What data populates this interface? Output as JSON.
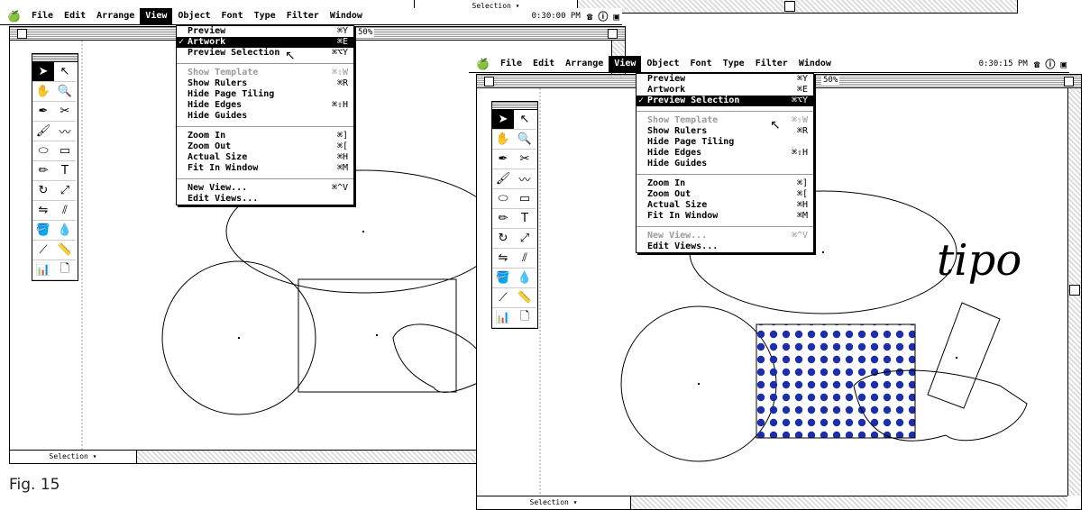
{
  "caption": "Fig. 15",
  "menubar": {
    "apple_icon": "apple-logo",
    "items": [
      "File",
      "Edit",
      "Arrange",
      "View",
      "Object",
      "Font",
      "Type",
      "Filter",
      "Window"
    ],
    "active_item": "View",
    "left_clock": "0:30:00 PM",
    "right_clock": "0:30:15 PM"
  },
  "top_strip": {
    "status_label": "Selection"
  },
  "left_window": {
    "zoom_label": "50%",
    "status_label": "Selection",
    "view_menu": [
      {
        "label": "Preview",
        "shortcut": "⌘Y",
        "disabled": false,
        "checked": false,
        "highlighted": false
      },
      {
        "label": "Artwork",
        "shortcut": "⌘E",
        "disabled": false,
        "checked": true,
        "highlighted": true
      },
      {
        "label": "Preview Selection",
        "shortcut": "⌘⌥Y",
        "disabled": false,
        "checked": false,
        "highlighted": false
      },
      {
        "separator": true
      },
      {
        "label": "Show Template",
        "shortcut": "⌘⇧W",
        "disabled": true,
        "checked": false,
        "highlighted": false
      },
      {
        "label": "Show Rulers",
        "shortcut": "⌘R",
        "disabled": false,
        "checked": false,
        "highlighted": false
      },
      {
        "label": "Hide Page Tiling",
        "shortcut": "",
        "disabled": false,
        "checked": false,
        "highlighted": false
      },
      {
        "label": "Hide Edges",
        "shortcut": "⌘⇧H",
        "disabled": false,
        "checked": false,
        "highlighted": false
      },
      {
        "label": "Hide Guides",
        "shortcut": "",
        "disabled": false,
        "checked": false,
        "highlighted": false
      },
      {
        "separator": true
      },
      {
        "label": "Zoom In",
        "shortcut": "⌘]",
        "disabled": false,
        "checked": false,
        "highlighted": false
      },
      {
        "label": "Zoom Out",
        "shortcut": "⌘[",
        "disabled": false,
        "checked": false,
        "highlighted": false
      },
      {
        "label": "Actual Size",
        "shortcut": "⌘H",
        "disabled": false,
        "checked": false,
        "highlighted": false
      },
      {
        "label": "Fit In Window",
        "shortcut": "⌘M",
        "disabled": false,
        "checked": false,
        "highlighted": false
      },
      {
        "separator": true
      },
      {
        "label": "New View...",
        "shortcut": "⌘^V",
        "disabled": false,
        "checked": false,
        "highlighted": false
      },
      {
        "label": "Edit Views...",
        "shortcut": "",
        "disabled": false,
        "checked": false,
        "highlighted": false
      }
    ]
  },
  "right_window": {
    "zoom_label": "50%",
    "status_label": "Selection",
    "artwork_text": "tipo",
    "pattern_color": "#1c2fa8",
    "view_menu": [
      {
        "label": "Preview",
        "shortcut": "⌘Y",
        "disabled": false,
        "checked": false,
        "highlighted": false
      },
      {
        "label": "Artwork",
        "shortcut": "⌘E",
        "disabled": false,
        "checked": false,
        "highlighted": false
      },
      {
        "label": "Preview Selection",
        "shortcut": "⌘⌥Y",
        "disabled": false,
        "checked": true,
        "highlighted": true
      },
      {
        "separator": true
      },
      {
        "label": "Show Template",
        "shortcut": "⌘⇧W",
        "disabled": true,
        "checked": false,
        "highlighted": false
      },
      {
        "label": "Show Rulers",
        "shortcut": "⌘R",
        "disabled": false,
        "checked": false,
        "highlighted": false
      },
      {
        "label": "Hide Page Tiling",
        "shortcut": "",
        "disabled": false,
        "checked": false,
        "highlighted": false
      },
      {
        "label": "Hide Edges",
        "shortcut": "⌘⇧H",
        "disabled": false,
        "checked": false,
        "highlighted": false
      },
      {
        "label": "Hide Guides",
        "shortcut": "",
        "disabled": false,
        "checked": false,
        "highlighted": false
      },
      {
        "separator": true
      },
      {
        "label": "Zoom In",
        "shortcut": "⌘]",
        "disabled": false,
        "checked": false,
        "highlighted": false
      },
      {
        "label": "Zoom Out",
        "shortcut": "⌘[",
        "disabled": false,
        "checked": false,
        "highlighted": false
      },
      {
        "label": "Actual Size",
        "shortcut": "⌘H",
        "disabled": false,
        "checked": false,
        "highlighted": false
      },
      {
        "label": "Fit In Window",
        "shortcut": "⌘M",
        "disabled": false,
        "checked": false,
        "highlighted": false
      },
      {
        "separator": true
      },
      {
        "label": "New View...",
        "shortcut": "⌘^V",
        "disabled": true,
        "checked": false,
        "highlighted": false
      },
      {
        "label": "Edit Views...",
        "shortcut": "",
        "disabled": false,
        "checked": false,
        "highlighted": false
      }
    ]
  },
  "tools": [
    {
      "icon": "selection-arrow-icon",
      "glyph": "➤"
    },
    {
      "icon": "direct-select-icon",
      "glyph": "↖"
    },
    {
      "icon": "hand-icon",
      "glyph": "✋"
    },
    {
      "icon": "zoom-icon",
      "glyph": "🔍"
    },
    {
      "icon": "pen-icon",
      "glyph": "✒"
    },
    {
      "icon": "scissors-icon",
      "glyph": "✂"
    },
    {
      "icon": "brush-icon",
      "glyph": "🖌"
    },
    {
      "icon": "freehand-icon",
      "glyph": "〰"
    },
    {
      "icon": "ellipse-icon",
      "glyph": "⬭"
    },
    {
      "icon": "rectangle-icon",
      "glyph": "▭"
    },
    {
      "icon": "pencil-icon",
      "glyph": "✏"
    },
    {
      "icon": "type-icon",
      "glyph": "T"
    },
    {
      "icon": "rotate-icon",
      "glyph": "↻"
    },
    {
      "icon": "scale-icon",
      "glyph": "⤢"
    },
    {
      "icon": "reflect-icon",
      "glyph": "⇋"
    },
    {
      "icon": "shear-icon",
      "glyph": "⫽"
    },
    {
      "icon": "paint-bucket-icon",
      "glyph": "🪣"
    },
    {
      "icon": "eyedropper-icon",
      "glyph": "💧"
    },
    {
      "icon": "blend-icon",
      "glyph": "⟋"
    },
    {
      "icon": "measure-icon",
      "glyph": "📏"
    },
    {
      "icon": "graph-icon",
      "glyph": "📊"
    },
    {
      "icon": "page-icon",
      "glyph": "🗋"
    }
  ]
}
